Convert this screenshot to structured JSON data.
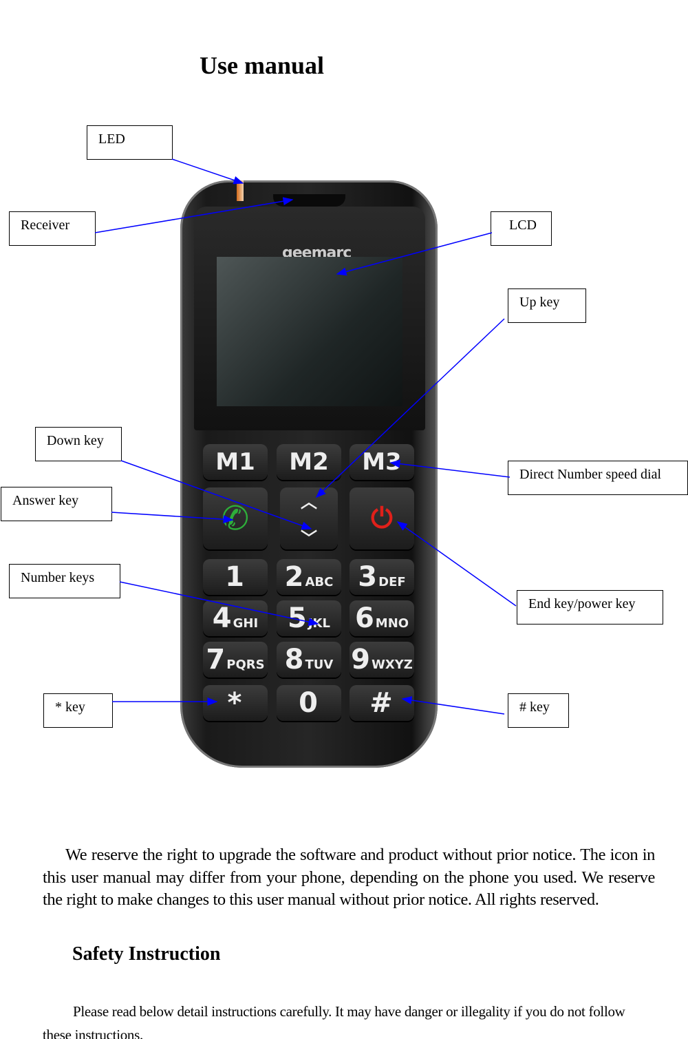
{
  "title": "Use manual",
  "phone": {
    "brand": "geemarc",
    "memory_keys": [
      "M1",
      "M2",
      "M3"
    ],
    "number_keys": [
      {
        "n": "1",
        "s": ""
      },
      {
        "n": "2",
        "s": "ABC"
      },
      {
        "n": "3",
        "s": "DEF"
      },
      {
        "n": "4",
        "s": "GHI"
      },
      {
        "n": "5",
        "s": "JKL"
      },
      {
        "n": "6",
        "s": "MNO"
      },
      {
        "n": "7",
        "s": "PQRS"
      },
      {
        "n": "8",
        "s": "TUV"
      },
      {
        "n": "9",
        "s": "WXYZ"
      },
      {
        "n": "*",
        "s": ""
      },
      {
        "n": "0",
        "s": ""
      },
      {
        "n": "#",
        "s": ""
      }
    ],
    "answer_icon": "phone-answer-icon",
    "end_icon": "phone-end-power-icon",
    "up_icon": "chevron-up-icon",
    "down_icon": "chevron-down-icon",
    "colors": {
      "arrow": "#0000ff",
      "answer": "#2eae3a",
      "end": "#e0201a"
    }
  },
  "labels": {
    "led": "LED",
    "receiver": "Receiver",
    "lcd": "LCD",
    "up": "Up key",
    "down": "Down key",
    "direct": "Direct Number speed dial",
    "answer": "Answer key",
    "end": "End key/power key",
    "number": "Number keys",
    "star": "* key",
    "hash": "# key"
  },
  "body": {
    "notice": "We reserve the right to upgrade the software and product without prior notice. The icon in this user manual may differ from your phone, depending on the phone you used. We reserve the right to make changes to this user manual without prior notice. All rights reserved.",
    "safety_heading": "Safety Instruction",
    "safety_text": "Please read below detail instructions carefully. It may have danger or illegality if you do not follow these instructions."
  }
}
